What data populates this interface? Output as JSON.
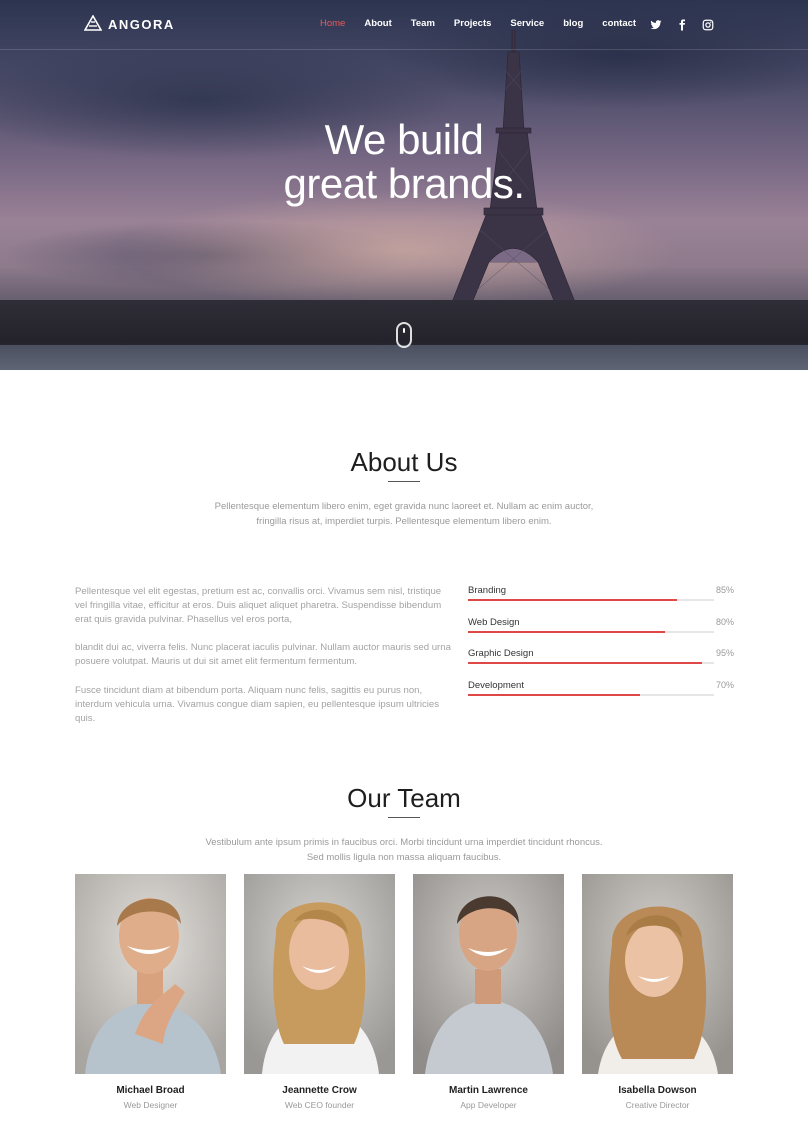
{
  "brand": {
    "name": "ANGORA"
  },
  "nav": {
    "items": [
      {
        "label": "Home",
        "active": true
      },
      {
        "label": "About",
        "active": false
      },
      {
        "label": "Team",
        "active": false
      },
      {
        "label": "Projects",
        "active": false
      },
      {
        "label": "Service",
        "active": false
      },
      {
        "label": "blog",
        "active": false
      },
      {
        "label": "contact",
        "active": false
      }
    ],
    "social": [
      "twitter-icon",
      "facebook-icon",
      "instagram-icon"
    ]
  },
  "hero": {
    "line1": "We build",
    "line2": "great brands."
  },
  "about": {
    "title": "About Us",
    "intro": "Pellentesque elementum libero enim, eget gravida nunc laoreet et. Nullam ac enim auctor, fringilla risus at, imperdiet turpis. Pellentesque elementum libero enim.",
    "paragraphs": [
      "Pellentesque vel elit egestas, pretium est ac, convallis orci. Vivamus sem nisl, tristique vel fringilla vitae, efficitur at eros. Duis aliquet aliquet pharetra. Suspendisse bibendum erat quis gravida pulvinar. Phasellus vel eros porta,",
      "blandit dui ac, viverra felis. Nunc placerat iaculis pulvinar. Nullam auctor mauris sed urna posuere volutpat. Mauris ut dui sit amet elit fermentum fermentum.",
      "Fusce tincidunt diam at bibendum porta. Aliquam nunc felis, sagittis eu purus non, interdum vehicula urna. Vivamus congue diam sapien, eu pellentesque ipsum ultricies quis."
    ],
    "skills": [
      {
        "name": "Branding",
        "percent": 85,
        "label": "85%"
      },
      {
        "name": "Web Design",
        "percent": 80,
        "label": "80%"
      },
      {
        "name": "Graphic Design",
        "percent": 95,
        "label": "95%"
      },
      {
        "name": "Development",
        "percent": 70,
        "label": "70%"
      }
    ]
  },
  "team": {
    "title": "Our Team",
    "intro": "Vestibulum ante ipsum primis in faucibus orci. Morbi tincidunt urna imperdiet tincidunt rhoncus. Sed mollis ligula non massa aliquam faucibus.",
    "members": [
      {
        "name": "Michael Broad",
        "role": "Web Designer"
      },
      {
        "name": "Jeannette Crow",
        "role": "Web CEO founder"
      },
      {
        "name": "Martin Lawrence",
        "role": "App Developer"
      },
      {
        "name": "Isabella Dowson",
        "role": "Creative Director"
      }
    ]
  },
  "colors": {
    "accent": "#e04848",
    "nav_active": "#e85a5a"
  }
}
